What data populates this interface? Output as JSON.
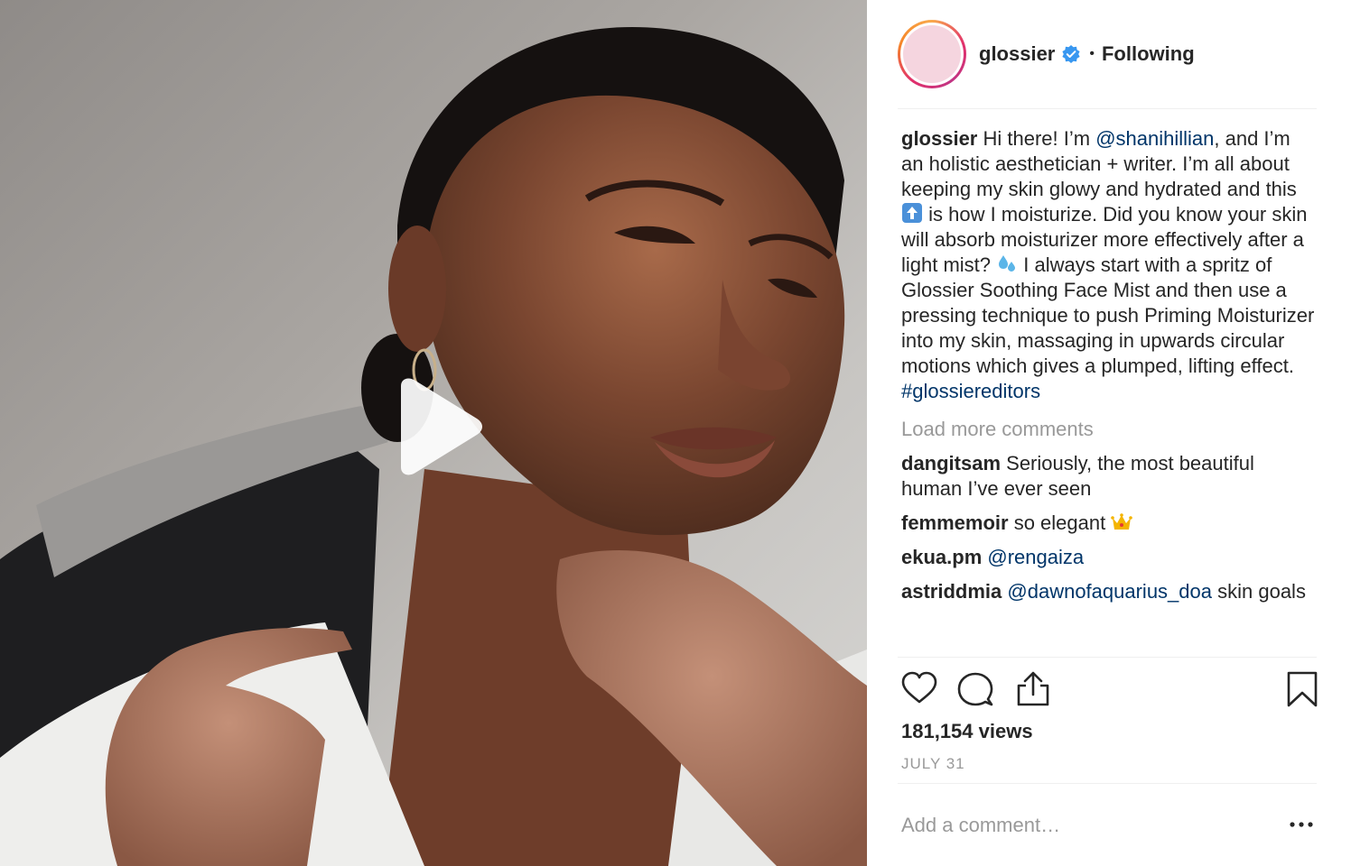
{
  "header": {
    "username": "glossier",
    "dot": "•",
    "follow_status": "Following"
  },
  "caption": {
    "username": "glossier",
    "part1": " Hi there! I’m ",
    "mention": "@shanihillian",
    "part2": ", and I’m an holistic aesthetician + writer. I’m all about keeping my skin glowy and hydrated and this ",
    "part3": " is how I moisturize. Did you know your skin will absorb moisturizer more effectively after a light mist? ",
    "part4": " I always start with a spritz of Glossier Soothing Face Mist and then use a pressing technique to push Priming Moisturizer into my skin, massaging in upwards circular motions which gives a plumped, lifting effect. ",
    "hashtag": "#glossiereditors"
  },
  "load_more": "Load more comments",
  "comments": [
    {
      "username": "dangitsam",
      "text": " Seriously, the most beautiful human I’ve ever seen"
    },
    {
      "username": "femmemoir",
      "text": " so elegant "
    },
    {
      "username": "ekua.pm",
      "mention": "@rengaiza"
    },
    {
      "username": "astriddmia",
      "mention": "@dawnofaquarius_doa",
      "text": " skin goals"
    }
  ],
  "stats": {
    "views": "181,154 views",
    "date": "JULY 31"
  },
  "add_comment": {
    "placeholder": "Add a comment…"
  },
  "colors": {
    "mention": "#003569",
    "muted": "#999999",
    "verified": "#3897f0",
    "avatar": "#f5d5df"
  },
  "icons": [
    "play-icon",
    "verified-badge-icon",
    "up-arrow-emoji-icon",
    "sweat-droplets-emoji-icon",
    "crown-emoji-icon",
    "heart-icon",
    "comment-icon",
    "share-icon",
    "bookmark-icon",
    "more-options-icon"
  ]
}
